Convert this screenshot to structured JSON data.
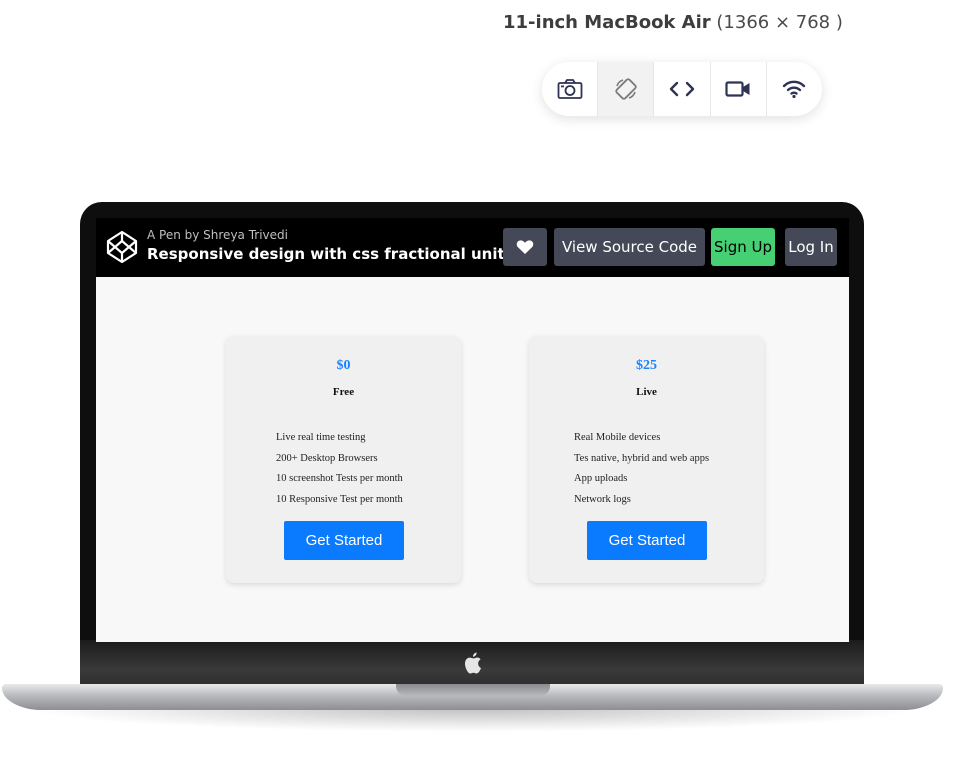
{
  "device": {
    "name": "11-inch MacBook Air",
    "resolution": "(1366 × 768 )"
  },
  "toolbar": {
    "tools": [
      "camera-icon",
      "rotate-icon",
      "code-icon",
      "video-icon",
      "wifi-icon"
    ]
  },
  "codepen": {
    "author": "A Pen by Shreya Trivedi",
    "title": "Responsive design with css fractional units",
    "view_source_label": "View Source Code",
    "signup_label": "Sign Up",
    "login_label": "Log In",
    "colors": {
      "header_bg": "#000000",
      "button_bg": "#444857",
      "signup_bg": "#47cf73"
    }
  },
  "pricing": {
    "accent": "#0a7bff",
    "plans": [
      {
        "price": "$0",
        "name": "Free",
        "features": [
          "Live real time testing",
          "200+ Desktop Browsers",
          "10 screenshot Tests per month",
          "10 Responsive Test per month"
        ],
        "cta": "Get Started"
      },
      {
        "price": "$25",
        "name": "Live",
        "features": [
          "Real Mobile devices",
          "Tes native, hybrid and web apps",
          "App uploads",
          "Network logs"
        ],
        "cta": "Get Started"
      }
    ]
  }
}
